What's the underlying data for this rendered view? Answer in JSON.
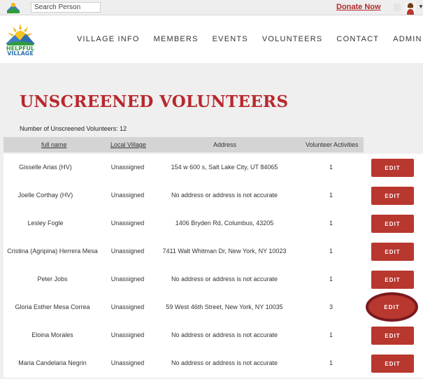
{
  "topbar": {
    "search_placeholder": "Search Person",
    "donate_label": "Donate Now"
  },
  "brand": {
    "logo_text_top": "HELPFUL",
    "logo_text_bottom": "VILLAGE",
    "color_primary": "#b8282d",
    "color_button": "#b8372e"
  },
  "nav": {
    "items": [
      "VILLAGE INFO",
      "MEMBERS",
      "EVENTS",
      "VOLUNTEERS",
      "CONTACT",
      "ADMIN"
    ]
  },
  "page": {
    "title": "UNSCREENED VOLUNTEERS",
    "count_text": "Number of Unscreened Volunteers: 12"
  },
  "table": {
    "headers": {
      "name": "full name",
      "village": "Local Village",
      "address": "Address",
      "activities": "Volunteer Activities"
    },
    "edit_label": "EDIT",
    "rows": [
      {
        "name": "Gisselle Arias (HV)",
        "village": "Unassigned",
        "address": "154 w 600 s, Salt Lake City, UT 84065",
        "activities": "1"
      },
      {
        "name": "Joelle Corthay (HV)",
        "village": "Unassigned",
        "address": "No address or address is not accurate",
        "activities": "1"
      },
      {
        "name": "Lesley Fogle",
        "village": "Unassigned",
        "address": "1406 Bryden Rd, Columbus, 43205",
        "activities": "1"
      },
      {
        "name": "Cristina (Agripina) Herrera Mesa",
        "village": "Unassigned",
        "address": "7411 Walt Whitman Dr, New York, NY 10023",
        "activities": "1"
      },
      {
        "name": "Peter Jobs",
        "village": "Unassigned",
        "address": "No address or address is not accurate",
        "activities": "1"
      },
      {
        "name": "Gloria Esther Mesa Correa",
        "village": "Unassigned",
        "address": "59 West 46th Street, New York, NY 10035",
        "activities": "3"
      },
      {
        "name": "Eloina Morales",
        "village": "Unassigned",
        "address": "No address or address is not accurate",
        "activities": "1"
      },
      {
        "name": "Maria Candelaria Negrin",
        "village": "Unassigned",
        "address": "No address or address is not accurate",
        "activities": "1"
      }
    ]
  }
}
